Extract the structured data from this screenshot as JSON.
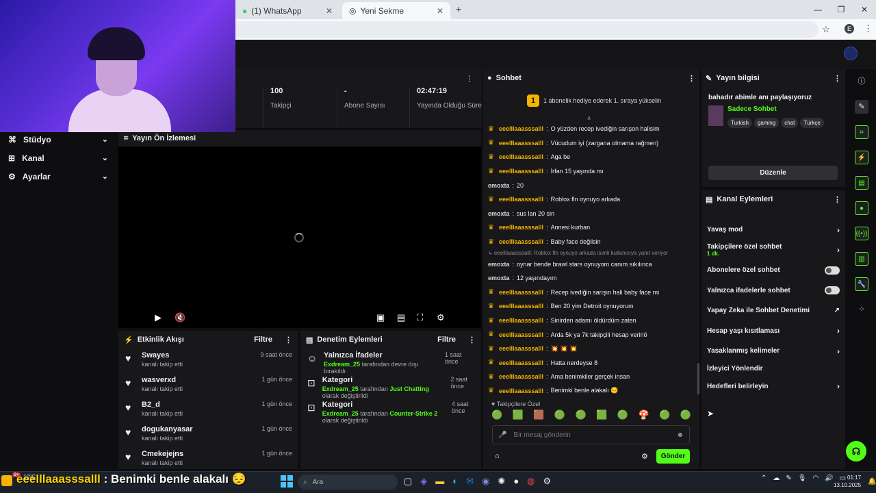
{
  "browser": {
    "tabs": [
      {
        "label": "(1) WhatsApp",
        "active": false
      },
      {
        "label": "Yeni Sekme",
        "active": true
      }
    ],
    "new_tab": "+",
    "profile_initial": "E",
    "window_controls": [
      "—",
      "❐",
      "✕"
    ]
  },
  "stats": [
    {
      "value": "100",
      "label": "Takipçi"
    },
    {
      "value": "-",
      "label": "Abone Sayısı"
    },
    {
      "value": "02:47:19",
      "label": "Yayında Olduğu Süre"
    }
  ],
  "leftnav": [
    {
      "label": "Stüdyo",
      "icon": "studio-icon"
    },
    {
      "label": "Kanal",
      "icon": "channel-icon"
    },
    {
      "label": "Ayarlar",
      "icon": "gear-icon"
    }
  ],
  "preview": {
    "title": "Yayın Ön İzlemesi"
  },
  "activity": {
    "title": "Etkinlik Akışı",
    "filter": "Filtre",
    "items": [
      {
        "user": "Swayes",
        "action": "kanalı takip etti",
        "time": "9 saat önce"
      },
      {
        "user": "wasverxd",
        "action": "kanalı takip etti",
        "time": "1 gün önce"
      },
      {
        "user": "B2_d",
        "action": "kanalı takip etti",
        "time": "1 gün önce"
      },
      {
        "user": "dogukanyasar",
        "action": "kanalı takip etti",
        "time": "1 gün önce"
      },
      {
        "user": "Cmekejejns",
        "action": "kanalı takip etti",
        "time": "1 gün önce"
      }
    ]
  },
  "moderation": {
    "title": "Denetim Eylemleri",
    "filter": "Filtre",
    "items": [
      {
        "title": "Yalnızca İfadeler",
        "actor": "Exdream_25",
        "text": "tarafından devre dışı bırakıldı",
        "extra": "",
        "time": "1 saat önce"
      },
      {
        "title": "Kategori",
        "actor": "Exdream_25",
        "text": "tarafından",
        "extra": "Just Chatting",
        "tail": "olarak değiştirildi",
        "time": "2 saat önce"
      },
      {
        "title": "Kategori",
        "actor": "Exdream_25",
        "text": "tarafından",
        "extra": "Counter-Strike 2",
        "tail": "olarak değiştirildi",
        "time": "4 saat önce"
      }
    ]
  },
  "chat": {
    "title": "Sohbet",
    "gift_badge": "1",
    "gift_text": "1 abonelik hediye ederek 1. sıraya yükselin",
    "messages": [
      {
        "user": "eeelllaaasssalll",
        "text": "O yüzden recep ivediğin sarışon halisim",
        "crown": true
      },
      {
        "user": "eeelllaaasssalll",
        "text": "Vücudum iyi (zargana olmama rağmen)",
        "crown": true
      },
      {
        "user": "eeelllaaasssalll",
        "text": "Aga be",
        "crown": true
      },
      {
        "user": "eeelllaaasssalll",
        "text": "İrfan 15 yaşında mı",
        "crown": true
      },
      {
        "user": "emoxta",
        "text": "20",
        "crown": false
      },
      {
        "user": "eeelllaaasssalll",
        "text": "Roblox fln oynuyo arkada",
        "crown": true
      },
      {
        "user": "emoxta",
        "text": "sus lan 20 sin",
        "crown": false
      },
      {
        "user": "eeelllaaasssalll",
        "text": "Annesi kurban",
        "crown": true
      },
      {
        "user": "eeelllaaasssalll",
        "text": "Baby face değilsin",
        "crown": true
      },
      {
        "reply": "↳ eeelllaaasssalll: Roblox fln oynuyo arkada isimli kullanıcıya yanıt veriyor"
      },
      {
        "user": "emoxta",
        "text": "oynar bende brawl stars oynuyom canım sıkılınca",
        "crown": false
      },
      {
        "user": "emoxta",
        "text": "12 yaşındayım",
        "crown": false
      },
      {
        "user": "eeelllaaasssalll",
        "text": "Recep ivediğin sarışın hali baby face mi",
        "crown": true
      },
      {
        "user": "eeelllaaasssalll",
        "text": "Ben 20 yim Detroit oynuyorum",
        "crown": true
      },
      {
        "user": "eeelllaaasssalll",
        "text": "Sinirden adamı öldürdüm zaten",
        "crown": true
      },
      {
        "user": "eeelllaaasssalll",
        "text": "Arda 5k ya 7k takipçili hesap veririö",
        "crown": true
      },
      {
        "user": "eeelllaaasssalll",
        "text": "💥 💥 💥",
        "crown": true
      },
      {
        "user": "eeelllaaasssalll",
        "text": "Hatta nerdeyse 8",
        "crown": true
      },
      {
        "user": "eeelllaaasssalll",
        "text": "Ama benimkiler gerçek insan",
        "crown": true
      },
      {
        "user": "eeelllaaasssalll",
        "text": "Benimki benle alakalı 😔",
        "crown": true
      }
    ],
    "followers_only": "Takipçilere Özel",
    "emotes": [
      "🟢",
      "🟩",
      "🟫",
      "🟢",
      "🟢",
      "🟩",
      "🟢",
      "🍄",
      "🟢",
      "🟢"
    ],
    "input_placeholder": "Bir mesaj gönderin",
    "send_label": "Gönder"
  },
  "stream_info": {
    "title": "Yayın bilgisi",
    "stream_title": "bahadır abimle anı paylaşıyoruz",
    "category": "Sadece Sohbet",
    "tags": [
      "Turkish",
      "gaming",
      "chat",
      "Türkçe"
    ],
    "edit_label": "Düzenle"
  },
  "channel_actions": {
    "title": "Kanal Eylemleri",
    "items": [
      {
        "label": "Yavaş mod",
        "kind": "arrow"
      },
      {
        "label": "Takipçilere özel sohbet",
        "sub": "1 dk.",
        "kind": "arrow"
      },
      {
        "label": "Abonelere özel sohbet",
        "kind": "toggle"
      },
      {
        "label": "Yalnızca ifadelerle sohbet",
        "kind": "toggle"
      },
      {
        "label": "Yapay Zeka ile Sohbet Denetimi",
        "kind": "external"
      },
      {
        "label": "Hesap yaşı kısıtlaması",
        "kind": "arrow"
      },
      {
        "label": "Yasaklanmış kelimeler",
        "kind": "arrow"
      },
      {
        "label": "İzleyici Yönlendir",
        "kind": "none"
      },
      {
        "label": "Hedefleri belirleyin",
        "kind": "arrow"
      }
    ]
  },
  "taskbar": {
    "overlay_user": "eeelllaaasssalll",
    "overlay_text": " : Benimki benle alakalı 😔",
    "weather_temp": "10°C",
    "notif_badge": "9+",
    "search": "Ara",
    "time": "01:17",
    "date": "13.10.2025"
  },
  "colors": {
    "accent": "#53fc18",
    "crown": "#f5b400",
    "background": "#0e0e10",
    "panel": "#18181b"
  }
}
